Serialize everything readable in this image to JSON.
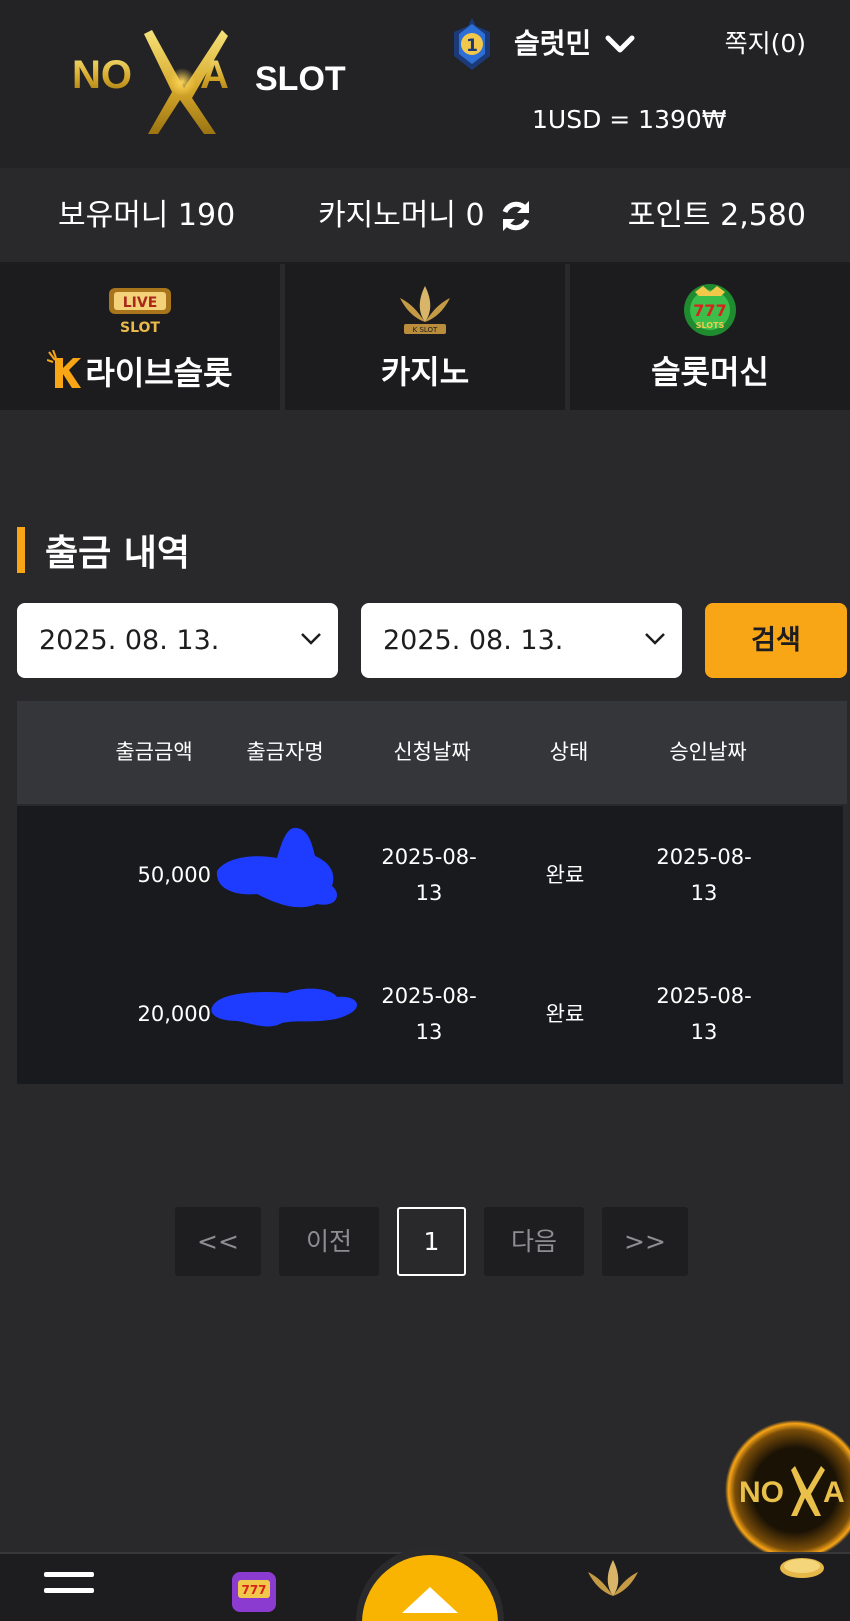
{
  "header": {
    "brand": "NOVA SLOT",
    "rank": "1",
    "username": "슬럿민",
    "messages": "쪽지(0)",
    "exchange_rate": "1USD = 1390₩"
  },
  "balances": {
    "hold_money": "보유머니 190",
    "casino_money": "카지노머니 0",
    "points": "포인트 2,580"
  },
  "games": [
    {
      "label": "라이브슬롯",
      "icon": "live-slot-icon"
    },
    {
      "label": "카지노",
      "icon": "k-slot-crown-icon"
    },
    {
      "label": "슬롯머신",
      "icon": "777-slots-icon"
    }
  ],
  "page_title": "출금 내역",
  "filter": {
    "date_from": "2025. 08. 13.",
    "date_to": "2025. 08. 13.",
    "search_label": "검색"
  },
  "table": {
    "headers": [
      "출금금액",
      "출금자명",
      "신청날짜",
      "상태",
      "승인날짜"
    ],
    "rows": [
      {
        "amount": "50,000",
        "name": "",
        "request_date": "2025-08-\n13",
        "status": "완료",
        "approval_date": "2025-08-\n13"
      },
      {
        "amount": "20,000",
        "name": "",
        "request_date": "2025-08-\n13",
        "status": "완료",
        "approval_date": "2025-08-\n13"
      }
    ]
  },
  "pagination": {
    "first": "<<",
    "prev": "이전",
    "current": "1",
    "next": "다음",
    "last": ">>"
  },
  "colors": {
    "accent": "#f8a516",
    "background": "#29292b",
    "redaction": "#1e3cff"
  }
}
